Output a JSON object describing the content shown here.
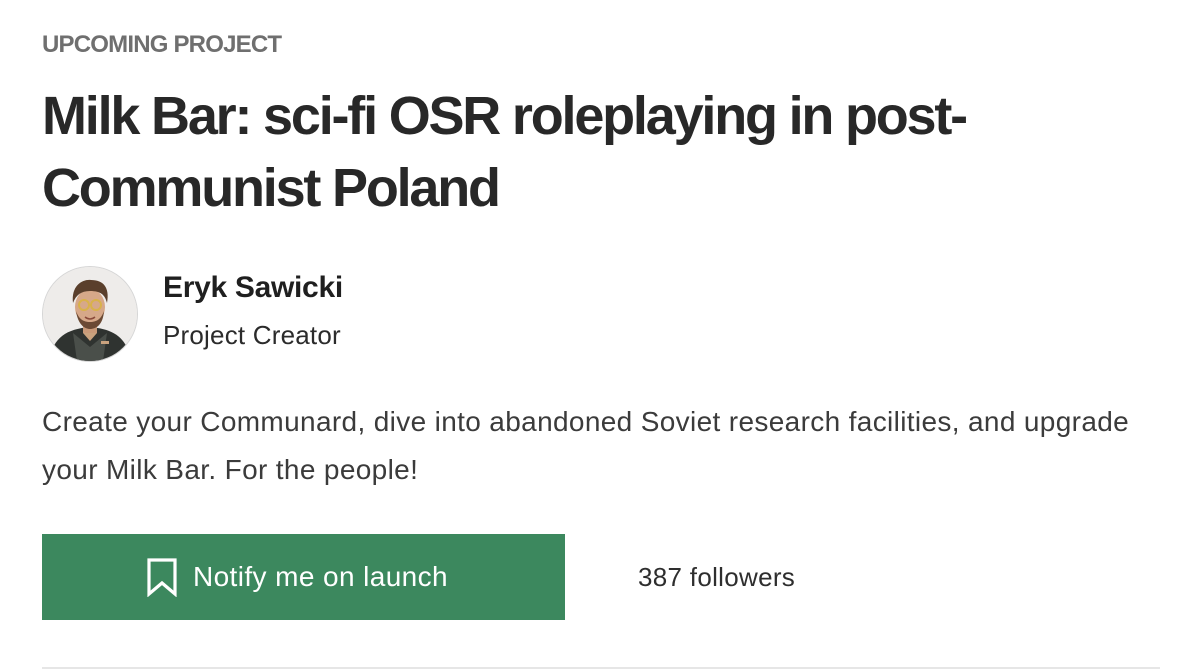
{
  "project": {
    "eyebrow": "UPCOMING PROJECT",
    "title": "Milk Bar: sci-fi OSR roleplaying in post-Communist Poland",
    "description": "Create your Communard, dive into abandoned Soviet research facilities, and upgrade your Milk Bar. For the people!"
  },
  "creator": {
    "name": "Eryk Sawicki",
    "role": "Project Creator"
  },
  "actions": {
    "notify_label": "Notify me on launch",
    "notify_icon": "bookmark-icon",
    "followers": "387 followers"
  },
  "colors": {
    "accent": "#3c885e",
    "eyebrow": "#6f6f6f",
    "text": "#282828",
    "divider": "#e6e6e6"
  }
}
